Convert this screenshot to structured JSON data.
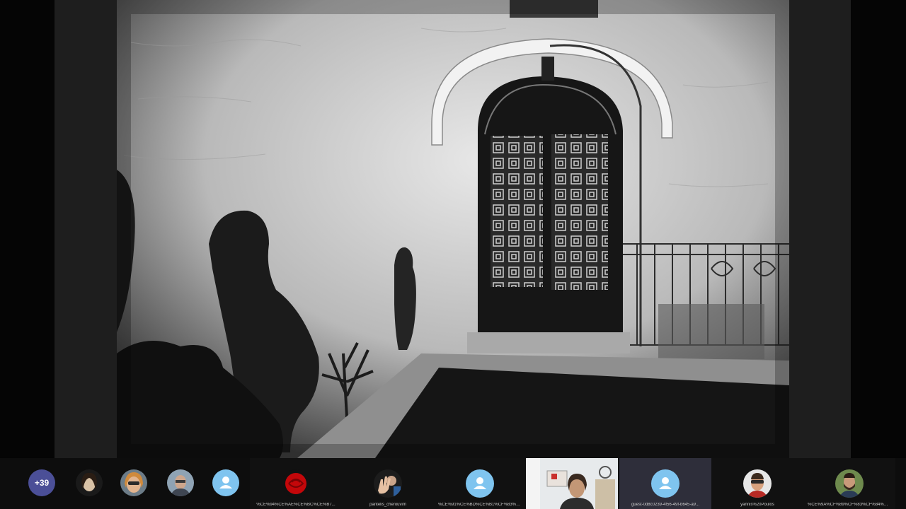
{
  "stage": {
    "content": "shared-photo"
  },
  "participants_strip": {
    "overflow_count": "+39",
    "avatars": [
      {
        "icon": "woman-dark-hair-avatar"
      },
      {
        "icon": "woman-sunglasses-avatar"
      },
      {
        "icon": "man-glasses-avatar"
      },
      {
        "icon": "default-person-icon"
      }
    ],
    "tiles": [
      {
        "name": "%CE%94%CE%AE%CE%BC%CE%B7...",
        "icon": "red-rose-icon"
      },
      {
        "name": "pantelis_cherouvim",
        "icon": "waving-hand-avatar"
      },
      {
        "name": "%CE%91%CE%BD%CE%B1%CF%83%CF%84...",
        "icon": "default-person-icon"
      },
      {
        "name": "",
        "icon": "participant-video"
      },
      {
        "name": "guest-0d8c0239-4f56-49f-b645-a9...",
        "icon": "default-person-icon"
      },
      {
        "name": "yannis%20Poulos",
        "icon": "man-sunglasses-avatar"
      },
      {
        "name": "%CE%9A%CF%89%CF%83%CF%84%CE%B1...",
        "icon": "man-beard-avatar"
      }
    ]
  },
  "colors": {
    "background": "#050505",
    "badge": "#4b4f97",
    "default_avatar": "#7fc4ef"
  }
}
